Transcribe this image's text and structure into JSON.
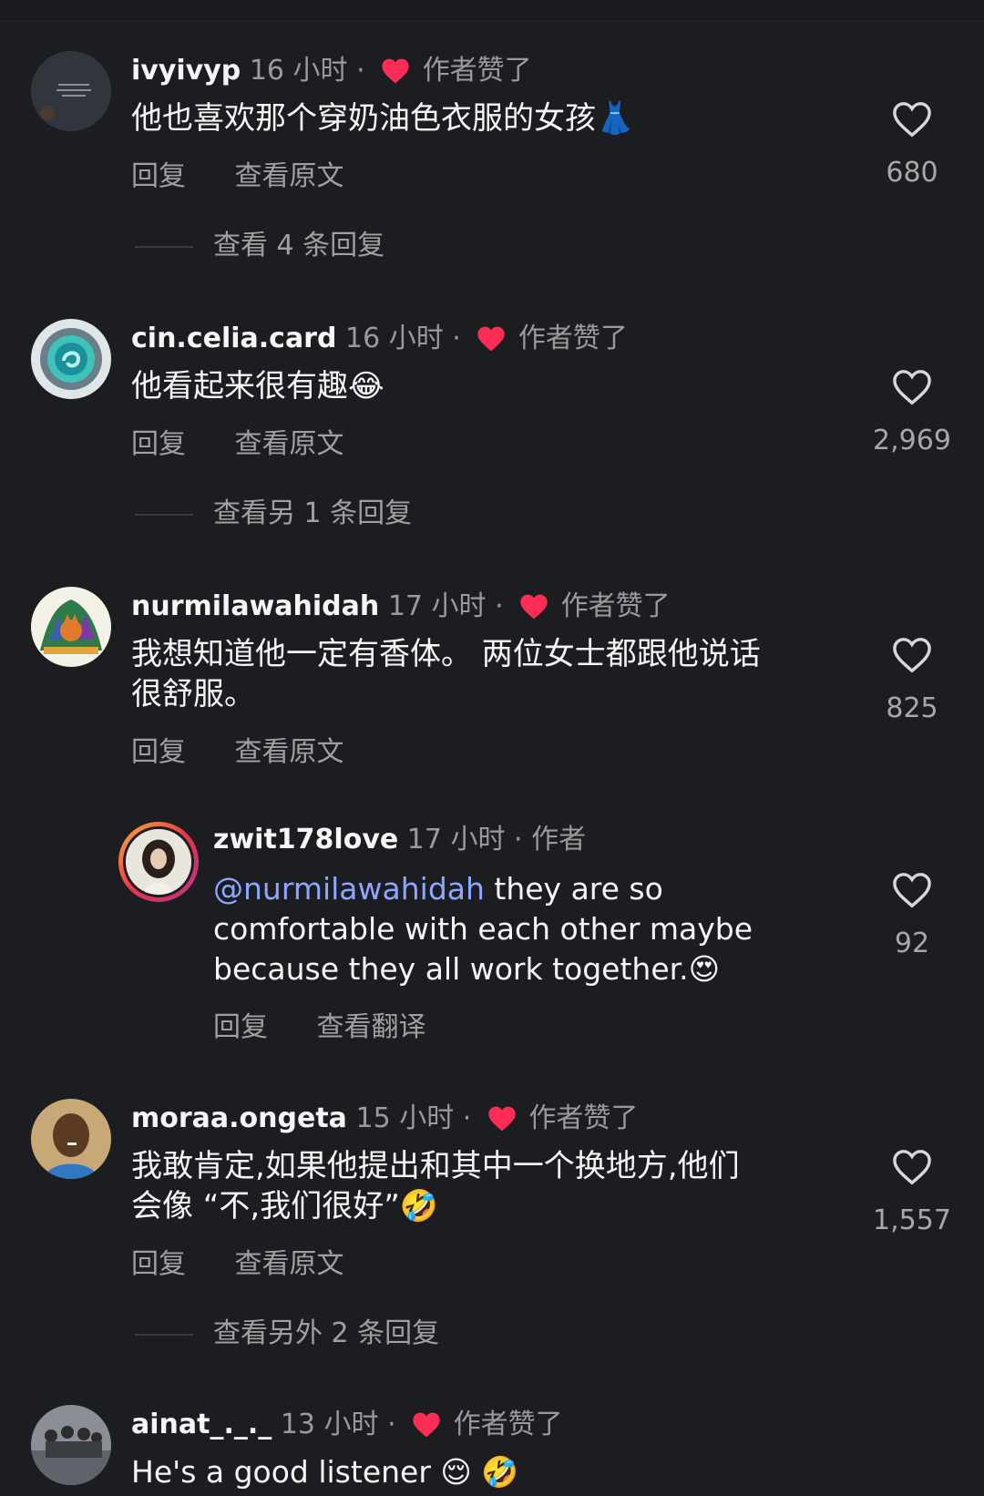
{
  "comments": [
    {
      "username": "ivyivyp",
      "time": "16 小时",
      "author_badge": "作者赞了",
      "text": "他也喜欢那个穿奶油色衣服的女孩",
      "emoji": "👗",
      "reply_label": "回复",
      "translate_label": "查看原文",
      "likes": "680",
      "view_replies": "查看 4 条回复"
    },
    {
      "username": "cin.celia.card",
      "time": "16 小时",
      "author_badge": "作者赞了",
      "text": "他看起来很有趣",
      "emoji": "😂",
      "reply_label": "回复",
      "translate_label": "查看原文",
      "likes": "2,969",
      "view_replies": "查看另 1 条回复"
    },
    {
      "username": "nurmilawahidah",
      "time": "17 小时",
      "author_badge": "作者赞了",
      "text_line1": "我想知道他一定有香体。 两位女士都跟他说话",
      "text_line2": "很舒服。",
      "reply_label": "回复",
      "translate_label": "查看原文",
      "likes": "825"
    },
    {
      "username": "zwit178love",
      "time": "17 小时",
      "author_badge": "作者",
      "mention": "@nurmilawahidah",
      "text_line1": " they are so",
      "text_line2": "comfortable with each other maybe",
      "text_line3": "because they all work together.",
      "emoji": "😍",
      "reply_label": "回复",
      "translate_label": "查看翻译",
      "likes": "92"
    },
    {
      "username": "moraa.ongeta",
      "time": "15 小时",
      "author_badge": "作者赞了",
      "text_line1": "我敢肯定,如果他提出和其中一个换地方,他们",
      "text_line2": "会像 “不,我们很好”",
      "emoji": "🤣",
      "reply_label": "回复",
      "translate_label": "查看原文",
      "likes": "1,557",
      "view_replies": "查看另外 2 条回复"
    },
    {
      "username": "ainat_._._",
      "time": "13 小时",
      "author_badge": "作者赞了",
      "text": "He's a good listener ",
      "emoji": "😌 🤣"
    }
  ],
  "separator": " · ",
  "colors": {
    "background": "#1c1d20",
    "text": "#f5f5f5",
    "muted": "#9a9a9a",
    "heart_red": "#ff2d55",
    "mention": "#8ea6ff"
  },
  "icons": {
    "like": "heart-outline-icon",
    "author_liked": "heart-filled-icon"
  }
}
